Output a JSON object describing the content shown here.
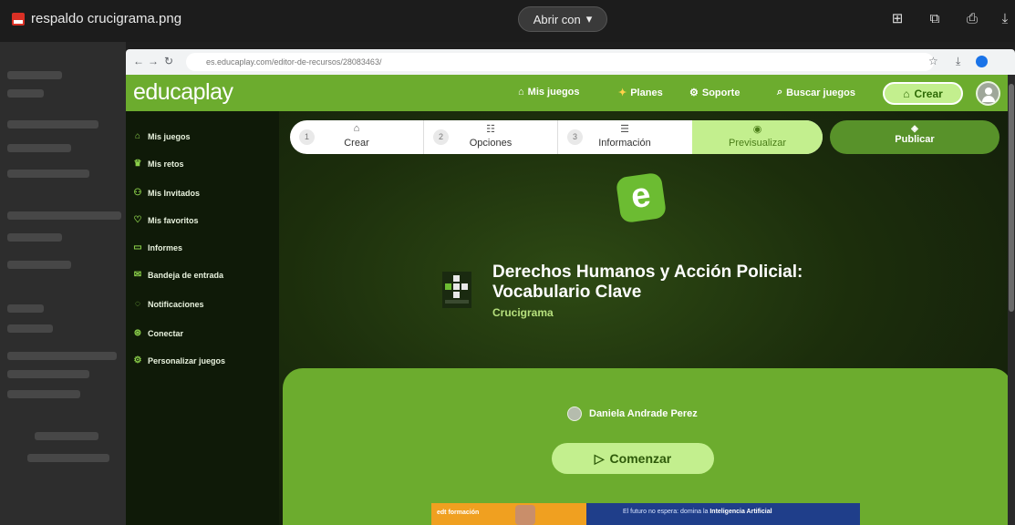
{
  "viewer": {
    "file_name": "respaldo crucigrama.png",
    "open_with": "Abrir con",
    "icons": [
      "add-to-drive-icon",
      "open-in-new-icon",
      "print-icon",
      "download-icon"
    ]
  },
  "browser": {
    "url": "es.educaplay.com/editor-de-recursos/28083463/"
  },
  "header": {
    "logo": "educaplay",
    "links": [
      {
        "label": "Mis juegos",
        "icon": "gamepad-icon"
      },
      {
        "label": "Planes",
        "icon": "star-icon"
      },
      {
        "label": "Soporte",
        "icon": "help-icon"
      },
      {
        "label": "Buscar juegos",
        "icon": "search-icon"
      }
    ],
    "crear": "Crear"
  },
  "sidebar": {
    "items": [
      {
        "label": "Mis juegos",
        "icon": "gamepad-icon"
      },
      {
        "label": "Mis retos",
        "icon": "trophy-icon"
      },
      {
        "label": "Mis Invitados",
        "icon": "users-icon"
      },
      {
        "label": "Mis favoritos",
        "icon": "heart-icon"
      },
      {
        "label": "Informes",
        "icon": "report-icon"
      },
      {
        "label": "Bandeja de entrada",
        "icon": "inbox-icon"
      },
      {
        "label": "Notificaciones",
        "icon": "bell-icon"
      },
      {
        "label": "Conectar",
        "icon": "link-icon"
      },
      {
        "label": "Personalizar juegos",
        "icon": "settings-icon"
      }
    ]
  },
  "steps": [
    {
      "num": "1",
      "label": "Crear"
    },
    {
      "num": "2",
      "label": "Opciones"
    },
    {
      "num": "3",
      "label": "Información"
    },
    {
      "num": "",
      "label": "Previsualizar"
    }
  ],
  "publish": "Publicar",
  "game": {
    "logo_letter": "e",
    "title": "Derechos Humanos y Acción Policial: Vocabulario Clave",
    "type": "Crucigrama",
    "author": "Daniela Andrade Perez",
    "start": "Comenzar"
  },
  "ad": {
    "brand": "edt formación",
    "text_prefix": "El futuro no espera: domina la",
    "text_bold": "Inteligencia Artificial"
  },
  "colors": {
    "brand_green": "#6cac2e",
    "light_green": "#c3ef8e",
    "dark_bg": "#10190a"
  }
}
